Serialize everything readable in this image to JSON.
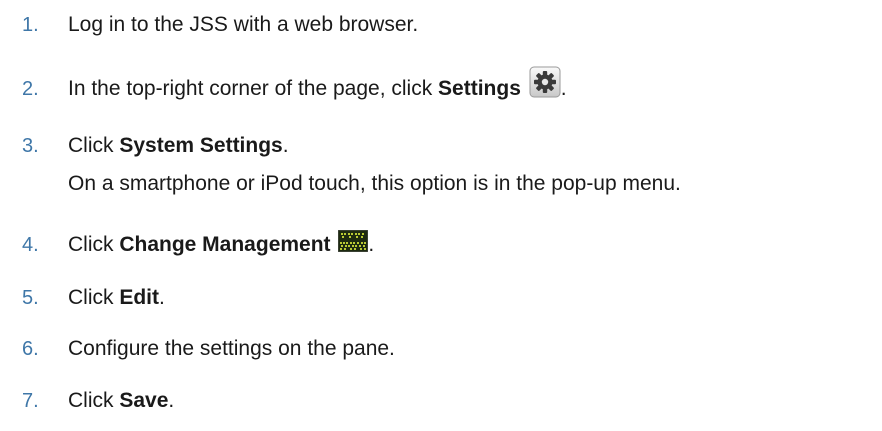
{
  "steps": [
    {
      "num": "1.",
      "parts": [
        "Log in to the JSS with a web browser."
      ]
    },
    {
      "num": "2.",
      "pre": "In the top-right corner of the page, click ",
      "bold": "Settings",
      "post": "."
    },
    {
      "num": "3.",
      "pre": "Click ",
      "bold": "System Settings",
      "post": "."
    },
    {
      "num": "4.",
      "pre": "Click ",
      "bold": "Change Management",
      "post": "."
    },
    {
      "num": "5.",
      "pre": "Click ",
      "bold": "Edit",
      "post": "."
    },
    {
      "num": "6.",
      "parts": [
        "Configure the settings on the pane."
      ]
    },
    {
      "num": "7.",
      "pre": "Click ",
      "bold": "Save",
      "post": "."
    }
  ],
  "step3_note": "On a smartphone or iPod touch, this option is in the pop-up menu.",
  "icons": {
    "settings": "gear-icon",
    "change_management": "change-management-icon"
  },
  "colors": {
    "number": "#3f77a8",
    "text": "#1a1a1a"
  }
}
